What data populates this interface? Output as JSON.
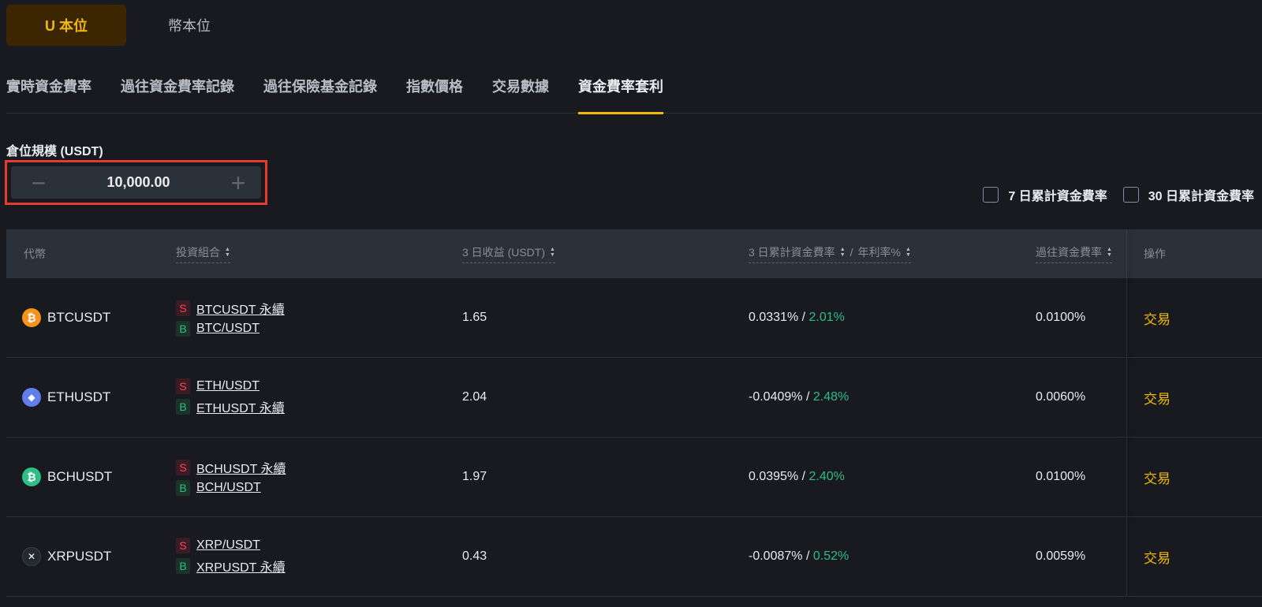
{
  "unit_tabs": {
    "active": "U 本位",
    "inactive": "幣本位"
  },
  "nav_tabs": [
    "實時資金費率",
    "過往資金費率記錄",
    "過往保險基金記錄",
    "指數價格",
    "交易數據",
    "資金費率套利"
  ],
  "position": {
    "label": "倉位規模 (USDT)",
    "value": "10,000.00",
    "minus": "−",
    "plus": "+"
  },
  "checkboxes": {
    "seven_day": "7 日累計資金費率",
    "thirty_day": "30 日累計資金費率"
  },
  "table": {
    "headers": {
      "coin": "代幣",
      "portfolio": "投資組合",
      "yield": "3 日收益 (USDT)",
      "rate": "3 日累計資金費率",
      "rate_sep": "/",
      "apr": "年利率%",
      "history": "過往資金費率",
      "action": "操作"
    },
    "rows": [
      {
        "coin": "BTCUSDT",
        "icon": "btc-icon",
        "icon_color": "#f7931a",
        "icon_glyph": "₿",
        "sell_badge": "S",
        "sell": "BTCUSDT 永續",
        "buy_badge": "B",
        "buy": "BTC/USDT",
        "yield": "1.65",
        "rate": "0.0331%",
        "apr": "2.01%",
        "history": "0.0100%",
        "action": "交易"
      },
      {
        "coin": "ETHUSDT",
        "icon": "eth-icon",
        "icon_color": "#627eea",
        "icon_glyph": "◆",
        "sell_badge": "S",
        "sell": "ETH/USDT",
        "buy_badge": "B",
        "buy": "ETHUSDT 永續",
        "yield": "2.04",
        "rate": "-0.0409%",
        "apr": "2.48%",
        "history": "0.0060%",
        "action": "交易"
      },
      {
        "coin": "BCHUSDT",
        "icon": "bch-icon",
        "icon_color": "#2ebd85",
        "icon_glyph": "₿",
        "sell_badge": "S",
        "sell": "BCHUSDT 永續",
        "buy_badge": "B",
        "buy": "BCH/USDT",
        "yield": "1.97",
        "rate": "0.0395%",
        "apr": "2.40%",
        "history": "0.0100%",
        "action": "交易"
      },
      {
        "coin": "XRPUSDT",
        "icon": "xrp-icon",
        "icon_color": "#23292f",
        "icon_glyph": "✕",
        "sell_badge": "S",
        "sell": "XRP/USDT",
        "buy_badge": "B",
        "buy": "XRPUSDT 永續",
        "yield": "0.43",
        "rate": "-0.0087%",
        "apr": "0.52%",
        "history": "0.0059%",
        "action": "交易"
      }
    ]
  },
  "colors": {
    "accent": "#f0b90b",
    "positive": "#2ebd85",
    "negative": "#f6465d",
    "highlight_box": "#e23d2e"
  }
}
